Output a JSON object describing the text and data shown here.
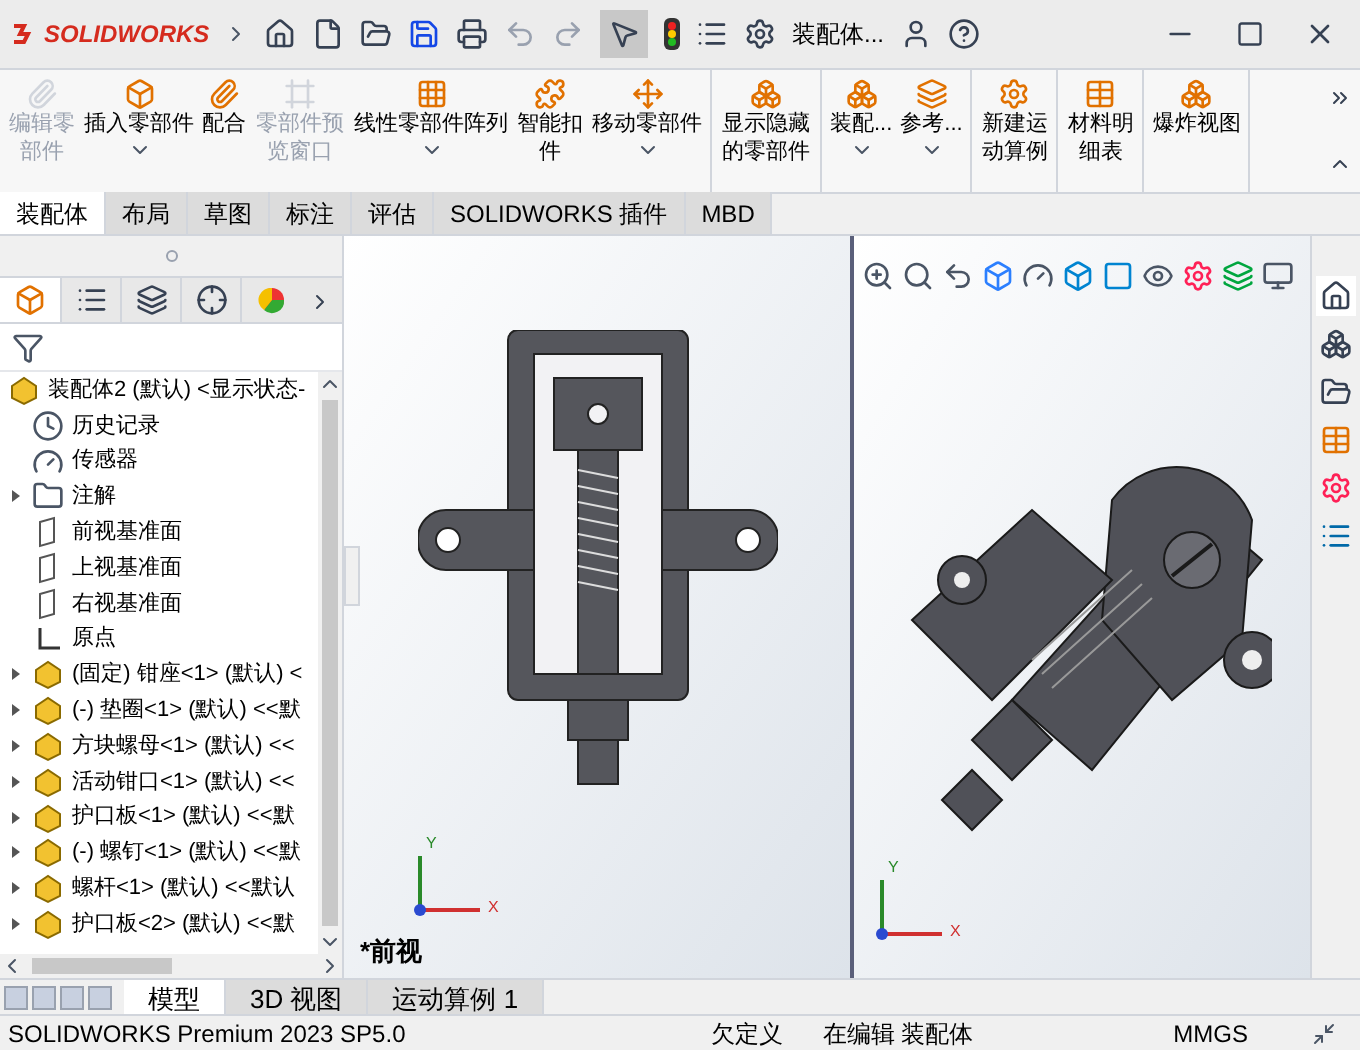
{
  "app": {
    "logo": "SOLIDWORKS",
    "document_title": "装配体..."
  },
  "ribbon": {
    "groups": [
      [
        {
          "label": "编辑零部件",
          "disabled": true,
          "dropdown": false
        },
        {
          "label": "插入零部件",
          "disabled": false,
          "dropdown": true
        },
        {
          "label": "配合",
          "disabled": false,
          "dropdown": false
        },
        {
          "label": "零部件预览窗口",
          "disabled": true,
          "dropdown": false
        },
        {
          "label": "线性零部件阵列",
          "disabled": false,
          "dropdown": true
        },
        {
          "label": "智能扣件",
          "disabled": false,
          "dropdown": false
        },
        {
          "label": "移动零部件",
          "disabled": false,
          "dropdown": true
        }
      ],
      [
        {
          "label": "显示隐藏的零部件",
          "disabled": false,
          "dropdown": false
        }
      ],
      [
        {
          "label": "装配...",
          "disabled": false,
          "dropdown": true
        },
        {
          "label": "参考...",
          "disabled": false,
          "dropdown": true
        }
      ],
      [
        {
          "label": "新建运动算例",
          "disabled": false,
          "dropdown": false
        }
      ],
      [
        {
          "label": "材料明细表",
          "disabled": false,
          "dropdown": false
        }
      ],
      [
        {
          "label": "爆炸视图",
          "disabled": false,
          "dropdown": false
        }
      ]
    ]
  },
  "command_tabs": [
    {
      "label": "装配体",
      "selected": true
    },
    {
      "label": "布局",
      "selected": false
    },
    {
      "label": "草图",
      "selected": false
    },
    {
      "label": "标注",
      "selected": false
    },
    {
      "label": "评估",
      "selected": false
    },
    {
      "label": "SOLIDWORKS 插件",
      "selected": false
    },
    {
      "label": "MBD",
      "selected": false
    }
  ],
  "feature_tree": {
    "root": "装配体2 (默认) <显示状态-",
    "items": [
      {
        "kind": "history",
        "label": "历史记录",
        "expander": false
      },
      {
        "kind": "sensor",
        "label": "传感器",
        "expander": false
      },
      {
        "kind": "annotation",
        "label": "注解",
        "expander": true
      },
      {
        "kind": "plane",
        "label": "前视基准面",
        "expander": false
      },
      {
        "kind": "plane",
        "label": "上视基准面",
        "expander": false
      },
      {
        "kind": "plane",
        "label": "右视基准面",
        "expander": false
      },
      {
        "kind": "origin",
        "label": "原点",
        "expander": false
      },
      {
        "kind": "part",
        "label": "(固定) 钳座<1> (默认) <",
        "expander": true
      },
      {
        "kind": "part",
        "label": "(-) 垫圈<1> (默认) <<默",
        "expander": true
      },
      {
        "kind": "part",
        "label": "方块螺母<1> (默认) <<",
        "expander": true
      },
      {
        "kind": "part",
        "label": "活动钳口<1> (默认) <<",
        "expander": true
      },
      {
        "kind": "part",
        "label": "护口板<1> (默认) <<默",
        "expander": true
      },
      {
        "kind": "part",
        "label": "(-) 螺钉<1> (默认) <<默",
        "expander": true
      },
      {
        "kind": "part",
        "label": "螺杆<1> (默认) <<默认",
        "expander": true
      },
      {
        "kind": "part",
        "label": "护口板<2> (默认) <<默",
        "expander": true
      }
    ]
  },
  "viewport_left": {
    "view_label": "*前视",
    "triad": {
      "y": "Y",
      "x": "X"
    }
  },
  "viewport_right": {
    "triad": {
      "y": "Y",
      "x": "X"
    }
  },
  "bottom_tabs": [
    {
      "label": "模型",
      "selected": true
    },
    {
      "label": "3D 视图",
      "selected": false
    },
    {
      "label": "运动算例 1",
      "selected": false
    }
  ],
  "status_bar": {
    "product": "SOLIDWORKS Premium 2023 SP5.0",
    "state": "欠定义",
    "mode": "在编辑 装配体",
    "units": "MMGS"
  }
}
